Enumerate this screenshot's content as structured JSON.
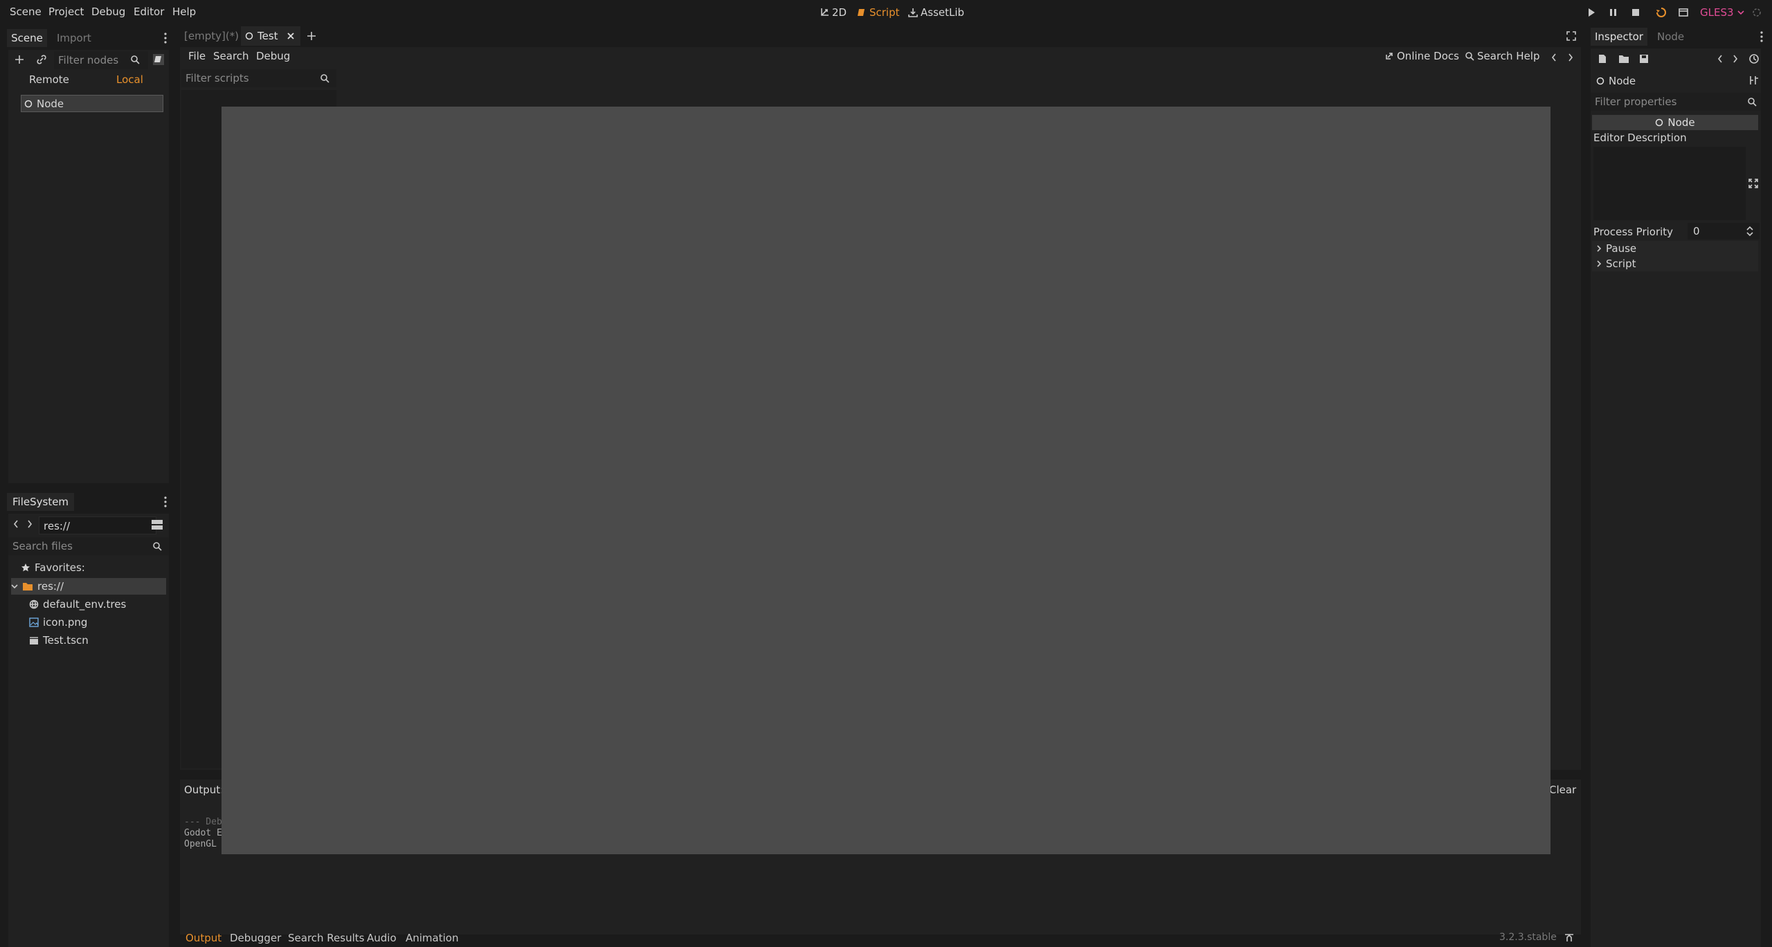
{
  "menu": {
    "items": [
      "Scene",
      "Project",
      "Debug",
      "Editor",
      "Help"
    ]
  },
  "modes": {
    "two_d": "2D",
    "script": "Script",
    "assetlib": "AssetLib"
  },
  "renderer": "GLES3",
  "colors": {
    "accent": "#e8902c",
    "renderer": "#e04c95",
    "background": "#1b1b1b",
    "panel": "#212121",
    "overlay": "#4b4b4b"
  },
  "scene_dock": {
    "tabs": [
      "Scene",
      "Import"
    ],
    "filter_placeholder": "Filter nodes",
    "remote": "Remote",
    "local": "Local",
    "root_node": "Node"
  },
  "filesystem": {
    "title": "FileSystem",
    "path": "res://",
    "search_placeholder": "Search files",
    "favorites": "Favorites:",
    "root": "res://",
    "files": [
      "default_env.tres",
      "icon.png",
      "Test.tscn"
    ]
  },
  "scene_tabs": {
    "empty": "[empty](*)",
    "test": "Test"
  },
  "script_editor": {
    "menu": [
      "File",
      "Search",
      "Debug"
    ],
    "online_docs": "Online Docs",
    "search_help": "Search Help",
    "filter_placeholder": "Filter scripts"
  },
  "output": {
    "label": "Output:",
    "clear": "Clear",
    "lines": [
      "--- Deb",
      "Godot E",
      "OpenGL "
    ]
  },
  "bottom_tabs": [
    "Output",
    "Debugger",
    "Search Results",
    "Audio",
    "Animation"
  ],
  "version": "3.2.3.stable",
  "inspector": {
    "tabs": [
      "Inspector",
      "Node"
    ],
    "object_name": "Node",
    "filter_placeholder": "Filter properties",
    "section": "Node",
    "editor_description": "Editor Description",
    "process_priority_label": "Process Priority",
    "process_priority_value": "0",
    "groups": [
      "Pause",
      "Script"
    ]
  }
}
